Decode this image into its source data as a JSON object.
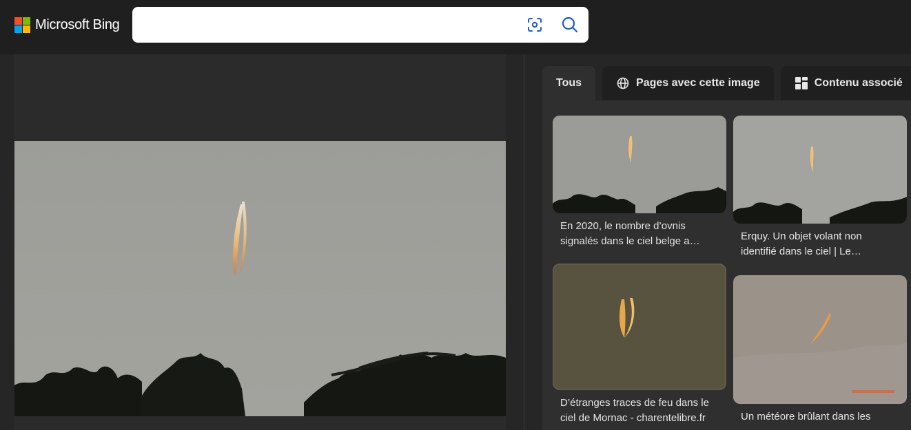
{
  "header": {
    "brand": "Microsoft Bing",
    "search_value": "",
    "colors": {
      "red": "#f25022",
      "green": "#7fba00",
      "blue": "#00a4ef",
      "yellow": "#ffb900"
    }
  },
  "tabs": [
    {
      "label": "Tous",
      "icon": ""
    },
    {
      "label": "Pages avec cette image",
      "icon": "globe-icon"
    },
    {
      "label": "Contenu associé",
      "icon": "grid-icon"
    }
  ],
  "results": [
    {
      "caption": "En 2020, le nombre d’ovnis signalés dans le ciel belge a…"
    },
    {
      "caption": "Erquy. Un objet volant non identifié dans le ciel | Le…"
    },
    {
      "caption": "D’étranges traces de feu dans le ciel de Mornac - charentelibre.fr"
    },
    {
      "caption": "Un météore brûlant dans les"
    }
  ]
}
